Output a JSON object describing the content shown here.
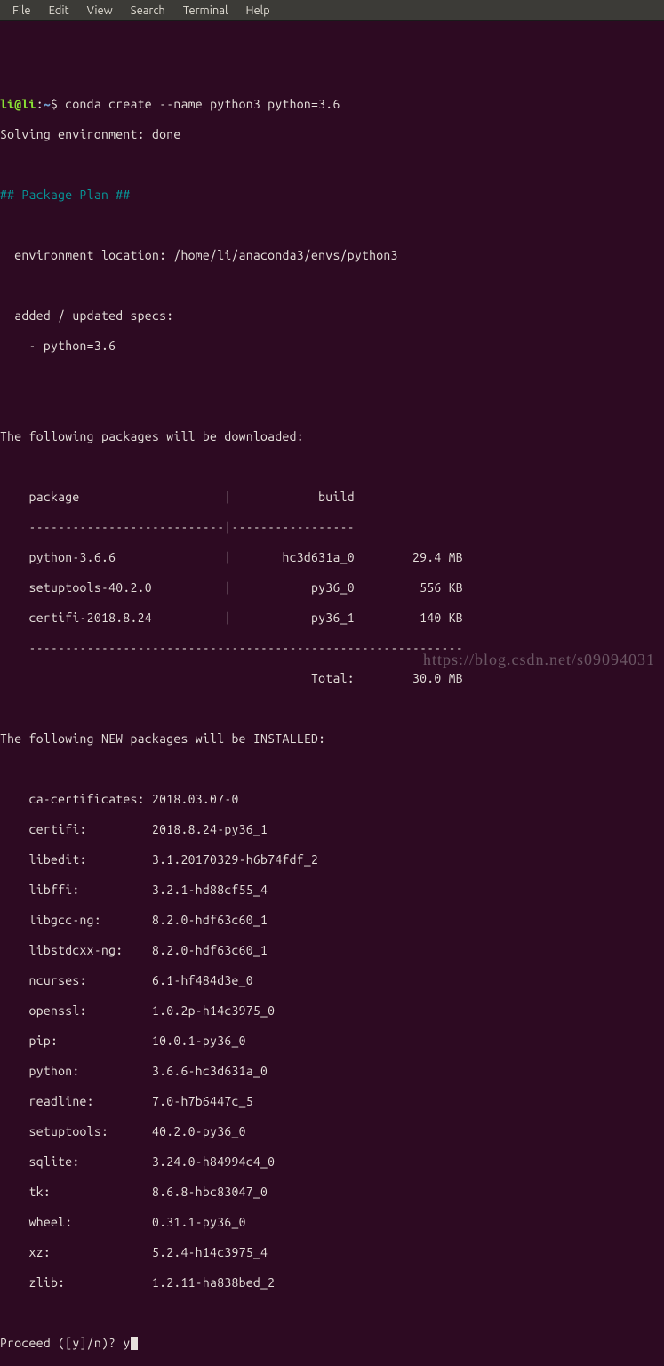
{
  "menu": {
    "items": [
      "File",
      "Edit",
      "View",
      "Search",
      "Terminal",
      "Help"
    ]
  },
  "prompt": {
    "user": "li@li",
    "colon": ":",
    "path": "~",
    "dollar": "$ ",
    "command": "conda create --name python3 python=3.6"
  },
  "solving": "Solving environment: done",
  "plan_header": "## Package Plan ##",
  "env_location": "  environment location: /home/li/anaconda3/envs/python3",
  "added_specs_label": "  added / updated specs:",
  "added_specs_item": "    - python=3.6",
  "dl_header": "The following packages will be downloaded:",
  "dl_table": {
    "header": "    package                    |            build",
    "sep1": "    ---------------------------|-----------------",
    "rows": [
      "    python-3.6.6               |       hc3d631a_0        29.4 MB",
      "    setuptools-40.2.0          |           py36_0         556 KB",
      "    certifi-2018.8.24          |           py36_1         140 KB"
    ],
    "sep2": "    ------------------------------------------------------------",
    "total": "                                           Total:        30.0 MB"
  },
  "install_header": "The following NEW packages will be INSTALLED:",
  "install_rows": [
    "    ca-certificates: 2018.03.07-0",
    "    certifi:         2018.8.24-py36_1",
    "    libedit:         3.1.20170329-h6b74fdf_2",
    "    libffi:          3.2.1-hd88cf55_4",
    "    libgcc-ng:       8.2.0-hdf63c60_1",
    "    libstdcxx-ng:    8.2.0-hdf63c60_1",
    "    ncurses:         6.1-hf484d3e_0",
    "    openssl:         1.0.2p-h14c3975_0",
    "    pip:             10.0.1-py36_0",
    "    python:          3.6.6-hc3d631a_0",
    "    readline:        7.0-h7b6447c_5",
    "    setuptools:      40.2.0-py36_0",
    "    sqlite:          3.24.0-h84994c4_0",
    "    tk:              8.6.8-hbc83047_0",
    "    wheel:           0.31.1-py36_0",
    "    xz:              5.2.4-h14c3975_4",
    "    zlib:            1.2.11-ha838bed_2"
  ],
  "proceed": {
    "question": "Proceed ([y]/n)? ",
    "answer": "y"
  },
  "watermark": "https://blog.csdn.net/s09094031"
}
